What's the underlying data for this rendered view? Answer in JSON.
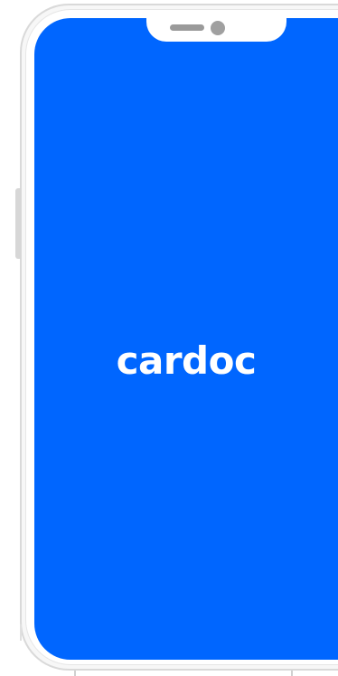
{
  "app": {
    "logo_text": "cardoc"
  },
  "colors": {
    "screen_background": "#0066ff",
    "logo_text": "#ffffff",
    "device_frame": "#d9d9d9"
  }
}
